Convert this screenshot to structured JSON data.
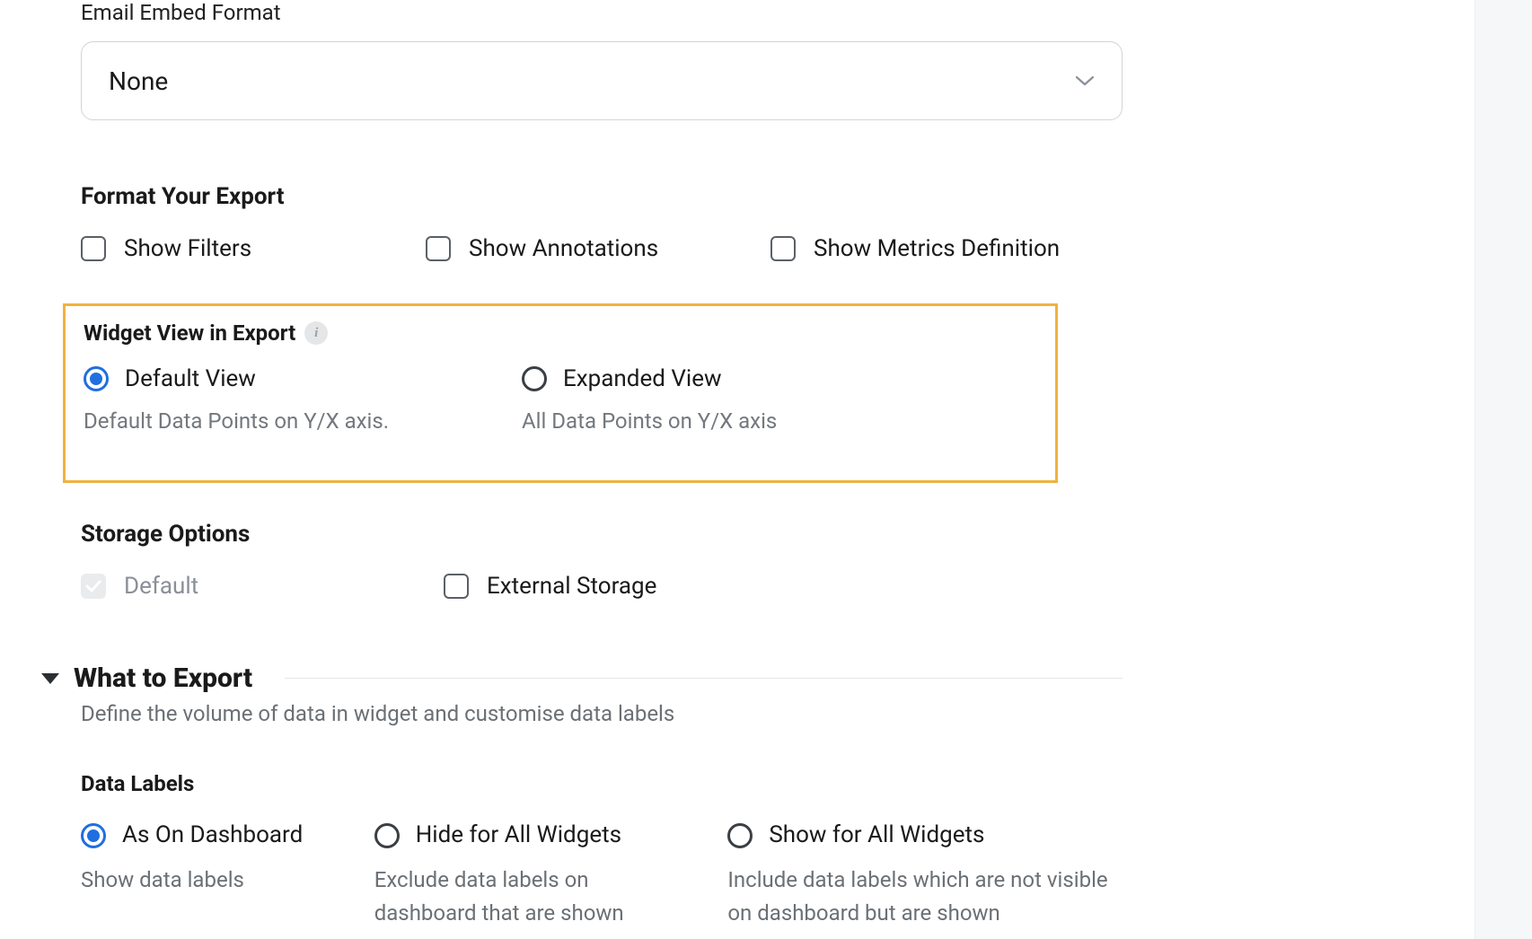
{
  "email_embed": {
    "label": "Email Embed Format",
    "value": "None"
  },
  "format_export": {
    "heading": "Format Your Export",
    "options": {
      "show_filters": "Show Filters",
      "show_annotations": "Show Annotations",
      "show_metrics_definition": "Show Metrics Definition"
    }
  },
  "widget_view": {
    "heading": "Widget View in Export",
    "default": {
      "label": "Default View",
      "desc": "Default Data Points on Y/X axis."
    },
    "expanded": {
      "label": "Expanded View",
      "desc": "All Data Points on Y/X axis"
    }
  },
  "storage": {
    "heading": "Storage Options",
    "default_label": "Default",
    "external_label": "External Storage"
  },
  "what_to_export": {
    "title": "What to Export",
    "desc": "Define the volume of data in widget and customise data labels"
  },
  "data_labels": {
    "heading": "Data Labels",
    "as_on_dashboard": {
      "label": "As On Dashboard",
      "desc": "Show data labels"
    },
    "hide_all": {
      "label": "Hide for All Widgets",
      "desc": "Exclude data labels on dashboard that are shown"
    },
    "show_all": {
      "label": "Show for All Widgets",
      "desc": "Include data labels which are not visible on dashboard but are shown"
    }
  }
}
